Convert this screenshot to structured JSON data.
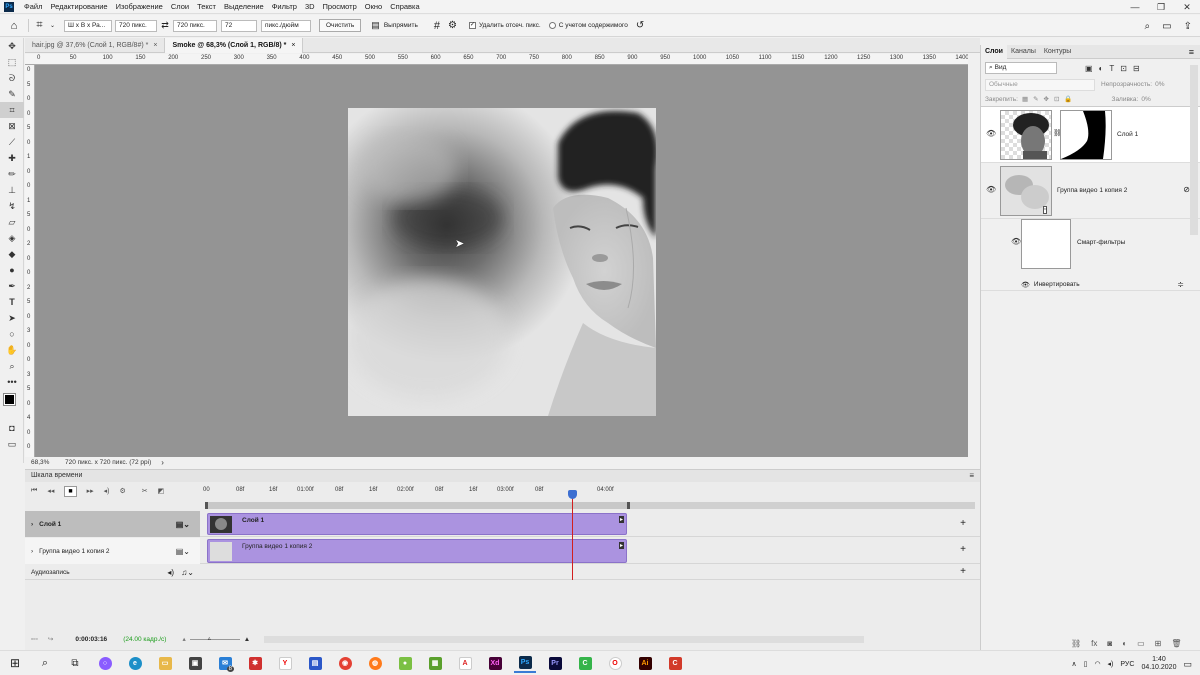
{
  "menubar": {
    "app_icon": "Ps",
    "items": [
      "Файл",
      "Редактирование",
      "Изображение",
      "Слои",
      "Текст",
      "Выделение",
      "Фильтр",
      "3D",
      "Просмотр",
      "Окно",
      "Справка"
    ],
    "window_controls": [
      "—",
      "❐",
      "✕"
    ]
  },
  "options": {
    "ratio": "Ш х В х Ра...",
    "width": "720 пикс.",
    "height": "720 пикс.",
    "resolution": "72",
    "units": "пикс./дюйм",
    "clear_label": "Очистить",
    "straighten_label": "Выпрямить",
    "delete_cropped_label": "Удалить отсеч. пикс.",
    "content_aware_label": "С учетом содержимого"
  },
  "tabs": [
    {
      "label": "hair.jpg @ 37,6% (Слой 1, RGB/8#) *",
      "close": "×"
    },
    {
      "label": "Smoke @ 68,3% (Слой 1, RGB/8) *",
      "close": "×"
    }
  ],
  "ruler_top": [
    "0",
    "50",
    "100",
    "150",
    "200",
    "250",
    "300",
    "350",
    "400",
    "450",
    "500",
    "550",
    "600",
    "650",
    "700",
    "750",
    "800",
    "850",
    "900",
    "950",
    "1000",
    "1050",
    "1100",
    "1150",
    "1200",
    "1250",
    "1300",
    "1350",
    "1400"
  ],
  "ruler_left": [
    "0",
    "5",
    "0",
    "0",
    "5",
    "0",
    "1",
    "0",
    "0",
    "1",
    "5",
    "0",
    "2",
    "0",
    "0",
    "2",
    "5",
    "0",
    "3",
    "0",
    "0",
    "3",
    "5",
    "0",
    "4",
    "0",
    "0"
  ],
  "status": {
    "zoom": "68,3%",
    "size": "720 пикс. х 720 пикс. (72 ppi)",
    "arrow": "›"
  },
  "panel": {
    "tabs": [
      "Слои",
      "Каналы",
      "Контуры"
    ],
    "filter_label": "Вид",
    "blend_mode": "Обычные",
    "opacity_label": "Непрозрачность:",
    "opacity_value": "0%",
    "lock_label": "Закрепить:",
    "fill_label": "Заливка:",
    "fill_value": "0%",
    "layers": [
      {
        "name": "Слой 1"
      },
      {
        "name": "Группа видео 1 копия 2"
      }
    ],
    "smart_filters_label": "Смарт-фильтры",
    "invert_label": "Инвертировать"
  },
  "timeline": {
    "title": "Шкала времени",
    "ticks": [
      "00",
      "08f",
      "16f",
      "01:00f",
      "08f",
      "16f",
      "02:00f",
      "08f",
      "16f",
      "03:00f",
      "08f",
      "04:00f"
    ],
    "tracks": [
      {
        "name": "Слой 1",
        "clip": "Слой 1"
      },
      {
        "name": "Группа видео 1 копия 2",
        "clip": "Группа видео 1 копия 2"
      },
      {
        "name": "Аудиозапись"
      }
    ],
    "timecode": "0:00:03:16",
    "fps": "(24.00 кадр./с)"
  },
  "taskbar": {
    "lang": "РУС",
    "time": "1:40",
    "date": "04.10.2020",
    "mail_badge": "8"
  },
  "colors": {
    "clip_fill": "#ab93e0",
    "playhead": "#d21f1f",
    "playhead_knob": "#3d6fd1",
    "workspace": "#949494"
  }
}
